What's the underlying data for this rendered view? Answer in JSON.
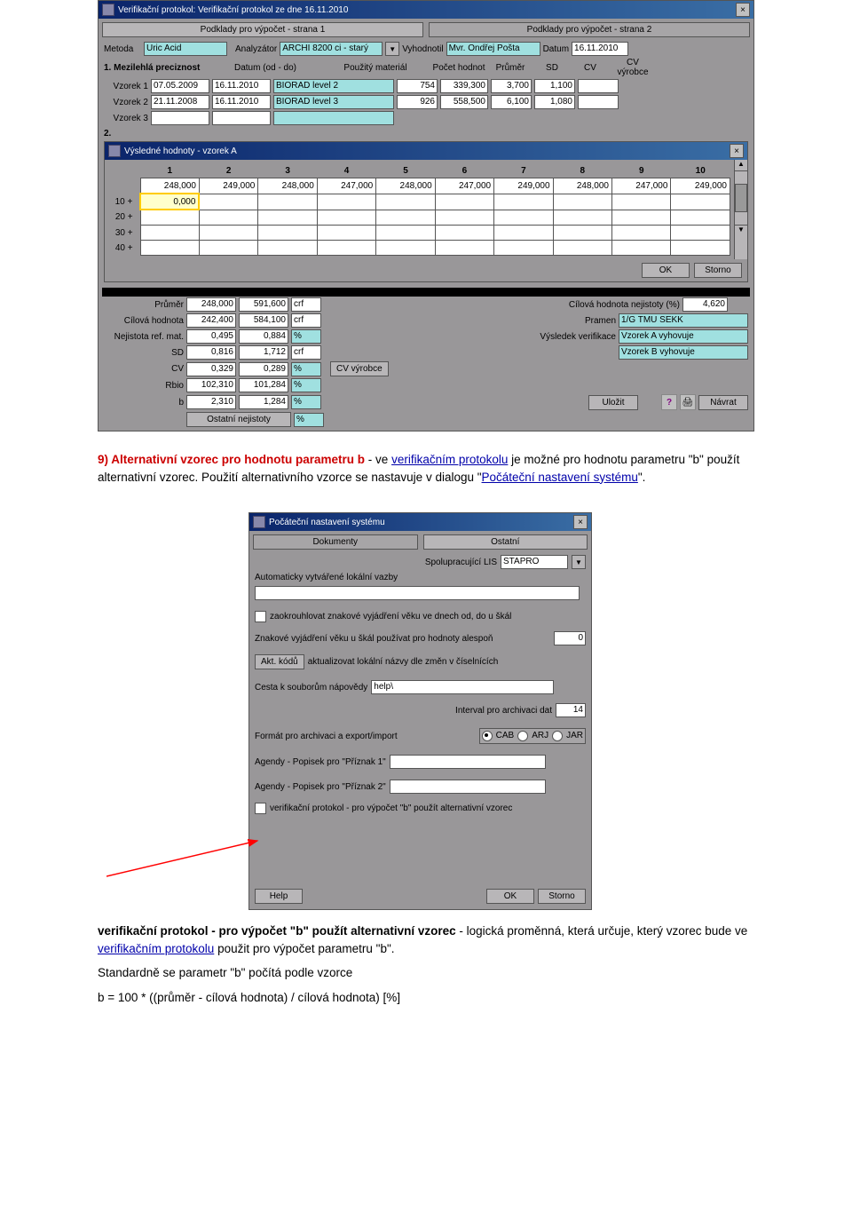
{
  "win1": {
    "title": "Verifikační protokol: Verifikační protokol ze dne 16.11.2010",
    "tab1": "Podklady pro výpočet - strana 1",
    "tab2": "Podklady pro výpočet - strana 2",
    "metoda_lbl": "Metoda",
    "metoda": "Uric Acid",
    "analyzator_lbl": "Analyzátor",
    "analyzator": "ARCHI 8200 ci - starý",
    "vyhodnotil_lbl": "Vyhodnotil",
    "vyhodnotil": "Mvr. Ondřej Pošta",
    "datum_lbl": "Datum",
    "datum": "16.11.2010",
    "section1": "1. Mezilehlá preciznost",
    "datum_od_lbl": "Datum (od - do)",
    "pouzity_material_lbl": "Použitý materiál",
    "pocet_hodnot_lbl": "Počet hodnot",
    "prumer_lbl_h": "Průměr",
    "sd_lbl_h": "SD",
    "cv_lbl_h": "CV",
    "cv_vyrobce_lbl_h": "CV výrobce",
    "vzorek1_lbl": "Vzorek 1",
    "vzorek2_lbl": "Vzorek 2",
    "vzorek3_lbl": "Vzorek 3",
    "v1": {
      "od": "07.05.2009",
      "do": "16.11.2010",
      "mat": "BIORAD level 2",
      "pocet": "754",
      "prumer": "339,300",
      "sd": "3,700",
      "cv": "1,100"
    },
    "v2": {
      "od": "21.11.2008",
      "do": "16.11.2010",
      "mat": "BIORAD level 3",
      "pocet": "926",
      "prumer": "558,500",
      "sd": "6,100",
      "cv": "1,080"
    },
    "section2": "2.",
    "subwin_title": "Výsledné hodnoty - vzorek A",
    "cols": [
      "1",
      "2",
      "3",
      "4",
      "5",
      "6",
      "7",
      "8",
      "9",
      "10"
    ],
    "row0_lbl": "",
    "row0": [
      "248,000",
      "249,000",
      "248,000",
      "247,000",
      "248,000",
      "247,000",
      "249,000",
      "248,000",
      "247,000",
      "249,000"
    ],
    "row10_lbl": "10 +",
    "row10_first": "0,000",
    "row20_lbl": "20 +",
    "row30_lbl": "30 +",
    "row40_lbl": "40 +",
    "ok_btn": "OK",
    "storno_btn": "Storno",
    "prumer_lbl": "Průměr",
    "cilova_hodnota_lbl": "Cílová hodnota",
    "nejistota_lbl": "Nejistota ref. mat.",
    "sd_lbl": "SD",
    "cv_lbl": "CV",
    "rbio_lbl": "Rbio",
    "b_lbl": "b",
    "ostatni_lbl": "Ostatní nejistoty",
    "colA": {
      "prumer": "248,000",
      "cil": "242,400",
      "nej": "0,495",
      "sd": "0,816",
      "cv": "0,329",
      "rbio": "102,310",
      "b": "2,310"
    },
    "colB": {
      "prumer": "591,600",
      "cil": "584,100",
      "nej": "0,884",
      "sd": "1,712",
      "cv": "0,289",
      "rbio": "101,284",
      "b": "1,284"
    },
    "unit_cf1": "crf",
    "unit_cf2": "crf",
    "unit_pct": "%",
    "unit_cf3": "crf",
    "cv_vyrobce_btn": "CV výrobce",
    "cilova_hodnota_nejistoty_lbl": "Cílová hodnota nejistoty (%)",
    "cilova_hodnota_nejistoty": "4,620",
    "pramen_lbl": "Pramen",
    "pramen": "1/G TMU SEKK",
    "vysledek_lbl": "Výsledek verifikace",
    "vysledek_a": "Vzorek A vyhovuje",
    "vysledek_b": "Vzorek B vyhovuje",
    "ulozit_btn": "Uložit",
    "navrat_btn": "Návrat"
  },
  "text1": {
    "heading": "9) Alternativní vzorec pro hodnotu parametru b",
    "p1a": " - ve ",
    "p1_link1": "verifikačním protokolu",
    "p1b": " je možné pro hodnotu parametru \"b\" použít alternativní vzorec. Použití alternativního vzorce se nastavuje v dialogu \"",
    "p1_link2": "Počáteční nastavení systému",
    "p1c": "\"."
  },
  "dialog2": {
    "title": "Počáteční nastavení systému",
    "tab_dokumenty": "Dokumenty",
    "tab_ostatni": "Ostatní",
    "lis_lbl": "Spolupracující LIS",
    "lis_val": "STAPRO",
    "auto_lbl": "Automaticky vytvářené lokální vazby",
    "chk1": "zaokrouhlovat znakové vyjádření věku ve dnech od, do u škál",
    "znak_lbl": "Znakové vyjádření věku u škál používat pro hodnoty alespoň",
    "znak_val": "0",
    "akt_kodu_btn": "Akt. kódů",
    "akt_lbl": "aktualizovat lokální názvy dle změn v číselnících",
    "cesta_lbl": "Cesta k souborům nápovědy",
    "cesta_val": "help\\",
    "interval_lbl": "Interval pro archivaci dat",
    "interval_val": "14",
    "format_lbl": "Formát pro archivaci a export/import",
    "fmt_cab": "CAB",
    "fmt_arj": "ARJ",
    "fmt_jar": "JAR",
    "ag1_lbl": "Agendy - Popisek pro \"Příznak 1\"",
    "ag2_lbl": "Agendy - Popisek pro \"Příznak 2\"",
    "chk2": "verifikační protokol - pro výpočet \"b\" použít alternativní vzorec",
    "help_btn": "Help",
    "ok_btn": "OK",
    "storno_btn": "Storno"
  },
  "text2": {
    "bold1": "verifikační protokol - pro výpočet \"b\" použít alternativní vzorec",
    "p1a": " - logická proměnná, která určuje, který vzorec bude ve ",
    "link1": "verifikačním protokolu",
    "p1b": "  použit pro výpočet parametru \"b\".",
    "p2": "Standardně se parametr \"b\" počítá podle vzorce",
    "p3": "b = 100 * ((průměr - cílová hodnota) / cílová hodnota) [%]"
  }
}
